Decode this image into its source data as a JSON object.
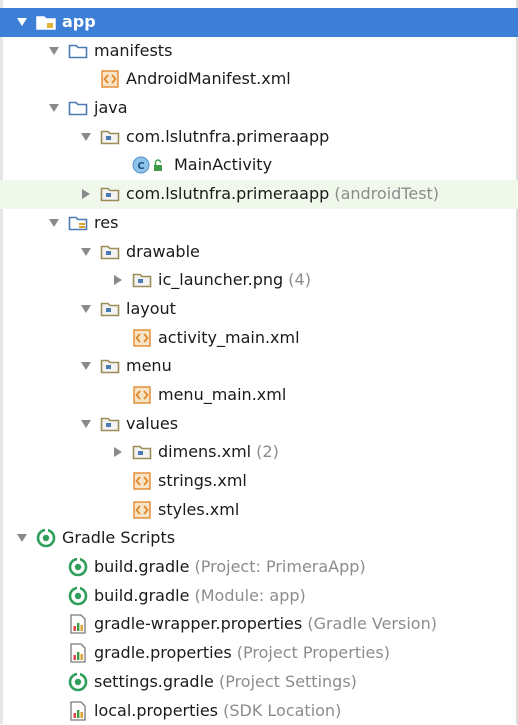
{
  "tree": [
    {
      "label": "app",
      "dim": "",
      "icon": "module-folder-icon",
      "arrow": "down",
      "level": 0,
      "selected": true
    },
    {
      "label": "manifests",
      "dim": "",
      "icon": "folder-icon",
      "arrow": "down",
      "level": 1
    },
    {
      "label": "AndroidManifest.xml",
      "dim": "",
      "icon": "xml-file-icon",
      "arrow": "none",
      "level": 2
    },
    {
      "label": "java",
      "dim": "",
      "icon": "folder-icon",
      "arrow": "down",
      "level": 1
    },
    {
      "label": "com.lslutnfra.primeraapp",
      "dim": "",
      "icon": "package-icon",
      "arrow": "down",
      "level": 2
    },
    {
      "label": "MainActivity",
      "dim": "",
      "icon": "class-icon",
      "arrow": "none",
      "level": 3
    },
    {
      "label": "com.lslutnfra.primeraapp",
      "dim": " (androidTest)",
      "icon": "package-icon",
      "arrow": "right",
      "level": 2,
      "highlight": true
    },
    {
      "label": "res",
      "dim": "",
      "icon": "res-folder-icon",
      "arrow": "down",
      "level": 1
    },
    {
      "label": "drawable",
      "dim": "",
      "icon": "package-icon",
      "arrow": "down",
      "level": 2
    },
    {
      "label": "ic_launcher.png",
      "dim": " (4)",
      "icon": "package-icon",
      "arrow": "right",
      "level": 3
    },
    {
      "label": "layout",
      "dim": "",
      "icon": "package-icon",
      "arrow": "down",
      "level": 2
    },
    {
      "label": "activity_main.xml",
      "dim": "",
      "icon": "xml-file-icon",
      "arrow": "none",
      "level": 3
    },
    {
      "label": "menu",
      "dim": "",
      "icon": "package-icon",
      "arrow": "down",
      "level": 2
    },
    {
      "label": "menu_main.xml",
      "dim": "",
      "icon": "xml-file-icon",
      "arrow": "none",
      "level": 3
    },
    {
      "label": "values",
      "dim": "",
      "icon": "package-icon",
      "arrow": "down",
      "level": 2
    },
    {
      "label": "dimens.xml",
      "dim": " (2)",
      "icon": "package-icon",
      "arrow": "right",
      "level": 3
    },
    {
      "label": "strings.xml",
      "dim": "",
      "icon": "xml-file-icon",
      "arrow": "none",
      "level": 3
    },
    {
      "label": "styles.xml",
      "dim": "",
      "icon": "xml-file-icon",
      "arrow": "none",
      "level": 3
    },
    {
      "label": "Gradle Scripts",
      "dim": "",
      "icon": "gradle-icon",
      "arrow": "down",
      "level": 0
    },
    {
      "label": "build.gradle",
      "dim": " (Project: PrimeraApp)",
      "icon": "gradle-icon",
      "arrow": "none",
      "level": 1
    },
    {
      "label": "build.gradle",
      "dim": " (Module: app)",
      "icon": "gradle-icon",
      "arrow": "none",
      "level": 1
    },
    {
      "label": "gradle-wrapper.properties",
      "dim": " (Gradle Version)",
      "icon": "properties-icon",
      "arrow": "none",
      "level": 1
    },
    {
      "label": "gradle.properties",
      "dim": " (Project Properties)",
      "icon": "properties-icon",
      "arrow": "none",
      "level": 1
    },
    {
      "label": "settings.gradle",
      "dim": " (Project Settings)",
      "icon": "gradle-icon",
      "arrow": "none",
      "level": 1
    },
    {
      "label": "local.properties",
      "dim": " (SDK Location)",
      "icon": "properties-icon",
      "arrow": "none",
      "level": 1
    }
  ],
  "colors": {
    "selection": "#3d7fd6",
    "highlight_row": "#f0f7eb",
    "dim_text": "#8c8c8c",
    "folder": "#4c7ab3",
    "gradle": "#2f9e5a",
    "xml": "#e08a2c"
  }
}
